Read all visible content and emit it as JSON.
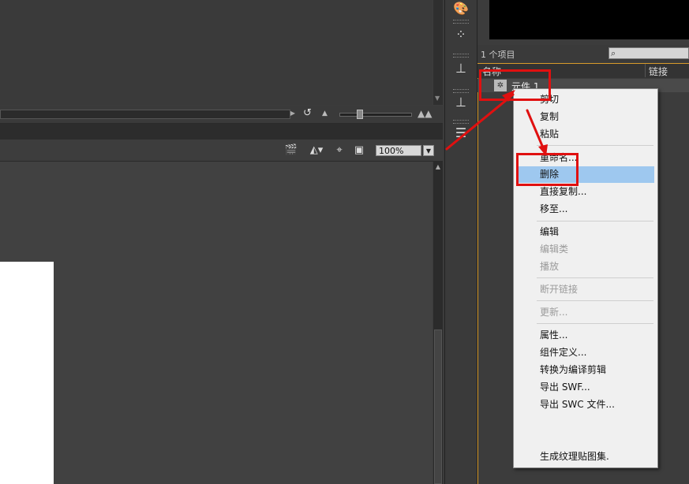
{
  "zoom": {
    "value": "100%"
  },
  "library": {
    "count_label": "1 个项目",
    "columns": {
      "name": "名称",
      "link": "链接"
    },
    "items": [
      {
        "label": "元件 1"
      }
    ]
  },
  "context_menu": {
    "highlighted": "删除",
    "items": [
      {
        "label": "剪切",
        "enabled": true
      },
      {
        "label": "复制",
        "enabled": true
      },
      {
        "label": "粘贴",
        "enabled": true
      },
      {
        "label": "重命名...",
        "enabled": true
      },
      {
        "label": "删除",
        "enabled": true
      },
      {
        "label": "直接复制...",
        "enabled": true
      },
      {
        "label": "移至...",
        "enabled": true
      },
      {
        "label": "编辑",
        "enabled": true
      },
      {
        "label": "编辑类",
        "enabled": false
      },
      {
        "label": "播放",
        "enabled": false
      },
      {
        "label": "断开链接",
        "enabled": false
      },
      {
        "label": "更新...",
        "enabled": false
      },
      {
        "label": "属性...",
        "enabled": true
      },
      {
        "label": "组件定义...",
        "enabled": true
      },
      {
        "label": "转换为编译剪辑",
        "enabled": true
      },
      {
        "label": "导出 SWF...",
        "enabled": true
      },
      {
        "label": "导出 SWC 文件...",
        "enabled": true
      },
      {
        "label": "生成纹理贴图集.",
        "enabled": true
      }
    ]
  },
  "colors": {
    "annotation": "#e01010",
    "highlight": "#9ec8ef",
    "panel_accent": "#d79a2a"
  },
  "icons": {
    "dock": [
      "palette-icon",
      "color-swatch-icon",
      "align-icon",
      "transform-icon",
      "info-icon"
    ],
    "toolbar": [
      "clapper-icon",
      "edit-symbols-icon",
      "snap-icon",
      "clip-icon"
    ]
  }
}
